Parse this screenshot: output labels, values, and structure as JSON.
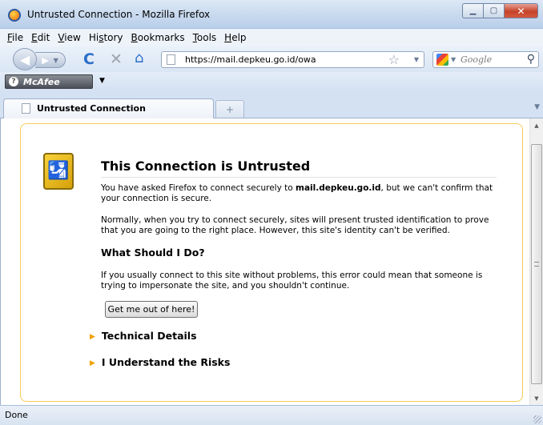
{
  "window": {
    "title": "Untrusted Connection - Mozilla Firefox",
    "minimize_glyph": "▁",
    "maximize_glyph": "▢",
    "close_glyph": "✕"
  },
  "menu": {
    "file": {
      "acc": "F",
      "rest": "ile"
    },
    "edit": {
      "acc": "E",
      "rest": "dit"
    },
    "view": {
      "acc": "V",
      "rest": "iew"
    },
    "history": {
      "pre": "Hi",
      "acc": "s",
      "rest": "tory"
    },
    "bookmarks": {
      "acc": "B",
      "rest": "ookmarks"
    },
    "tools": {
      "acc": "T",
      "rest": "ools"
    },
    "help": {
      "acc": "H",
      "rest": "elp"
    }
  },
  "navbar": {
    "back_glyph": "◀",
    "forward_glyph": "▶",
    "dropdown_glyph": "▼",
    "reload_glyph": "C",
    "stop_glyph": "✕",
    "home_glyph": "⌂",
    "url": "https://mail.depkeu.go.id/owa",
    "star_glyph": "☆",
    "search_placeholder": "Google",
    "search_glyph": "⚲"
  },
  "addon_bar": {
    "mcafee_label": "McAfee",
    "mcafee_icon_glyph": "?",
    "dropdown_glyph": "▼"
  },
  "tabs": {
    "active_label": "Untrusted Connection",
    "new_tab_glyph": "+",
    "list_glyph": "▼"
  },
  "error_page": {
    "icon_glyph": "🛂",
    "title": "This Connection is Untrusted",
    "p1_pre": "You have asked Firefox to connect securely to ",
    "p1_host": "mail.depkeu.go.id",
    "p1_post": ", but we can't confirm that your connection is secure.",
    "p2": "Normally, when you try to connect securely, sites will present trusted identification to prove that you are going to the right place. However, this site's identity can't be verified.",
    "subheading": "What Should I Do?",
    "p3": "If you usually connect to this site without problems, this error could mean that someone is trying to impersonate the site, and you shouldn't continue.",
    "button_label": "Get me out of here!",
    "expander_arrow": "▶",
    "technical_details": "Technical Details",
    "understand_risks": "I Understand the Risks"
  },
  "scrollbar": {
    "up_glyph": "▲",
    "down_glyph": "▼"
  },
  "status": {
    "text": "Done"
  },
  "colors": {
    "error_box_border": "#f4cc56",
    "expander_arrow": "#f0a000",
    "chrome_blue": "#d4e1f2"
  }
}
